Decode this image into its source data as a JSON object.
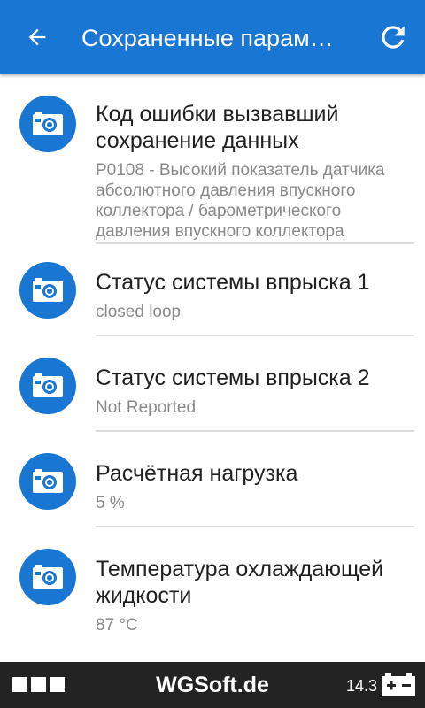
{
  "appbar": {
    "title": "Сохраненные парам…",
    "back_icon": "arrow-back-icon",
    "refresh_icon": "refresh-icon",
    "color": "#1976d2"
  },
  "items": [
    {
      "icon": "camera-icon",
      "primary": "Код ошибки вызвавший сохранение данных",
      "secondary": "P0108 - Высокий показатель датчика абсолютного давления впускного коллектора / барометрического давления впускного коллектора"
    },
    {
      "icon": "camera-icon",
      "primary": "Статус системы впрыска 1",
      "secondary": "closed loop"
    },
    {
      "icon": "camera-icon",
      "primary": "Статус системы впрыска 2",
      "secondary": "Not Reported"
    },
    {
      "icon": "camera-icon",
      "primary": "Расчётная нагрузка",
      "secondary": "5 %"
    },
    {
      "icon": "camera-icon",
      "primary": "Температура охлаждающей жидкости",
      "secondary": "87 °C"
    }
  ],
  "bottombar": {
    "brand": "WGSoft.de",
    "voltage": "14.3",
    "battery_icon": "battery-icon",
    "menu_icon": "menu-squares-icon"
  }
}
